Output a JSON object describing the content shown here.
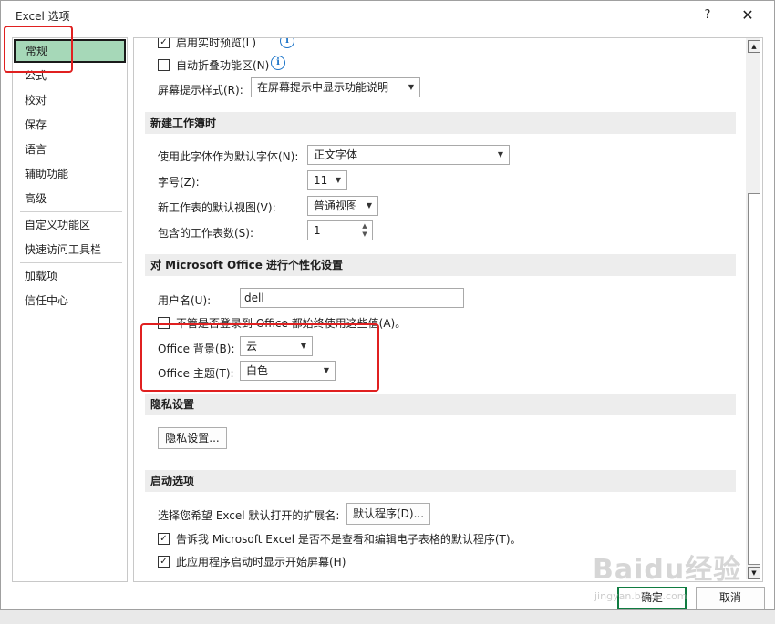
{
  "window": {
    "title": "Excel 选项",
    "help": "?",
    "close": "✕"
  },
  "sidebar": {
    "items": [
      {
        "label": "常规"
      },
      {
        "label": "公式"
      },
      {
        "label": "校对"
      },
      {
        "label": "保存"
      },
      {
        "label": "语言"
      },
      {
        "label": "辅助功能"
      },
      {
        "label": "高级"
      },
      {
        "label": "自定义功能区"
      },
      {
        "label": "快速访问工具栏"
      },
      {
        "label": "加载项"
      },
      {
        "label": "信任中心"
      }
    ],
    "selected": "常规"
  },
  "ui_options": {
    "live_preview": "启用实时预览(L)",
    "collapse_ribbon": "自动折叠功能区(N)",
    "screentip_label": "屏幕提示样式(R):",
    "screentip_value": "在屏幕提示中显示功能说明"
  },
  "new_workbook": {
    "header": "新建工作簿时",
    "font_label": "使用此字体作为默认字体(N):",
    "font_value": "正文字体",
    "size_label": "字号(Z):",
    "size_value": "11",
    "view_label": "新工作表的默认视图(V):",
    "view_value": "普通视图",
    "sheets_label": "包含的工作表数(S):",
    "sheets_value": "1"
  },
  "personalize": {
    "header": "对 Microsoft Office 进行个性化设置",
    "username_label": "用户名(U):",
    "username_value": "dell",
    "always_use": "不管是否登录到 Office 都始终使用这些值(A)。",
    "background_label": "Office 背景(B):",
    "background_value": "云",
    "theme_label": "Office 主题(T):",
    "theme_value": "白色"
  },
  "privacy": {
    "header": "隐私设置",
    "button": "隐私设置..."
  },
  "startup": {
    "header": "启动选项",
    "ext_label": "选择您希望 Excel 默认打开的扩展名:",
    "ext_button": "默认程序(D)...",
    "tell_me": "告诉我 Microsoft Excel 是否不是查看和编辑电子表格的默认程序(T)。",
    "show_start": "此应用程序启动时显示开始屏幕(H)"
  },
  "footer": {
    "ok": "确定",
    "cancel": "取消"
  },
  "watermark": {
    "text": "Baidu经验",
    "url": "jingyan.baidu.com"
  },
  "colors": {
    "selected_nav": "#a6d8b8",
    "highlight": "#e02020",
    "ok_border": "#107c41"
  }
}
